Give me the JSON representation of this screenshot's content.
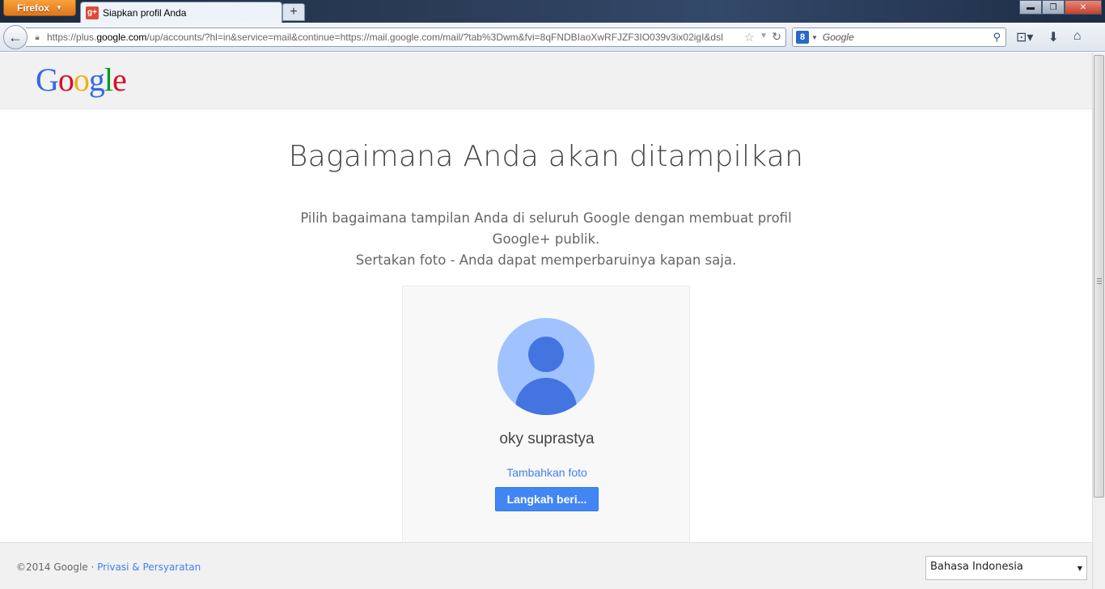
{
  "browser": {
    "menu_button": "Firefox",
    "tab_title": "Siapkan profil Anda",
    "tab_icon": "g+",
    "new_tab": "+",
    "url_prefix": "https://plus.",
    "url_domain": "google.com",
    "url_rest": "/up/accounts/?hl=in&service=mail&continue=https://mail.google.com/mail/?tab%3Dwm&fvi=8qFNDBIaoXwRFJZF3IO039v3ix02igI&dsl",
    "search_engine_icon": "8",
    "search_placeholder": "Google"
  },
  "header": {
    "logo_letters": [
      "G",
      "o",
      "o",
      "g",
      "l",
      "e"
    ]
  },
  "main": {
    "heading": "Bagaimana Anda akan ditampilkan",
    "desc_line1": "Pilih bagaimana tampilan Anda di seluruh Google dengan membuat profil",
    "desc_line2": "Google+ publik.",
    "desc_line3": "Sertakan foto - Anda dapat memperbaruinya kapan saja."
  },
  "profile_card": {
    "name": "oky suprastya",
    "add_photo": "Tambahkan foto",
    "next_button": "Langkah beri..."
  },
  "footer": {
    "copyright": "©2014 Google ·",
    "privacy_link": "Privasi & Persyaratan",
    "language": "Bahasa Indonesia"
  },
  "colors": {
    "accent": "#4285f4",
    "link": "#427fed",
    "avatar_bg": "#a0c3ff",
    "avatar_fg": "#4374e0"
  }
}
